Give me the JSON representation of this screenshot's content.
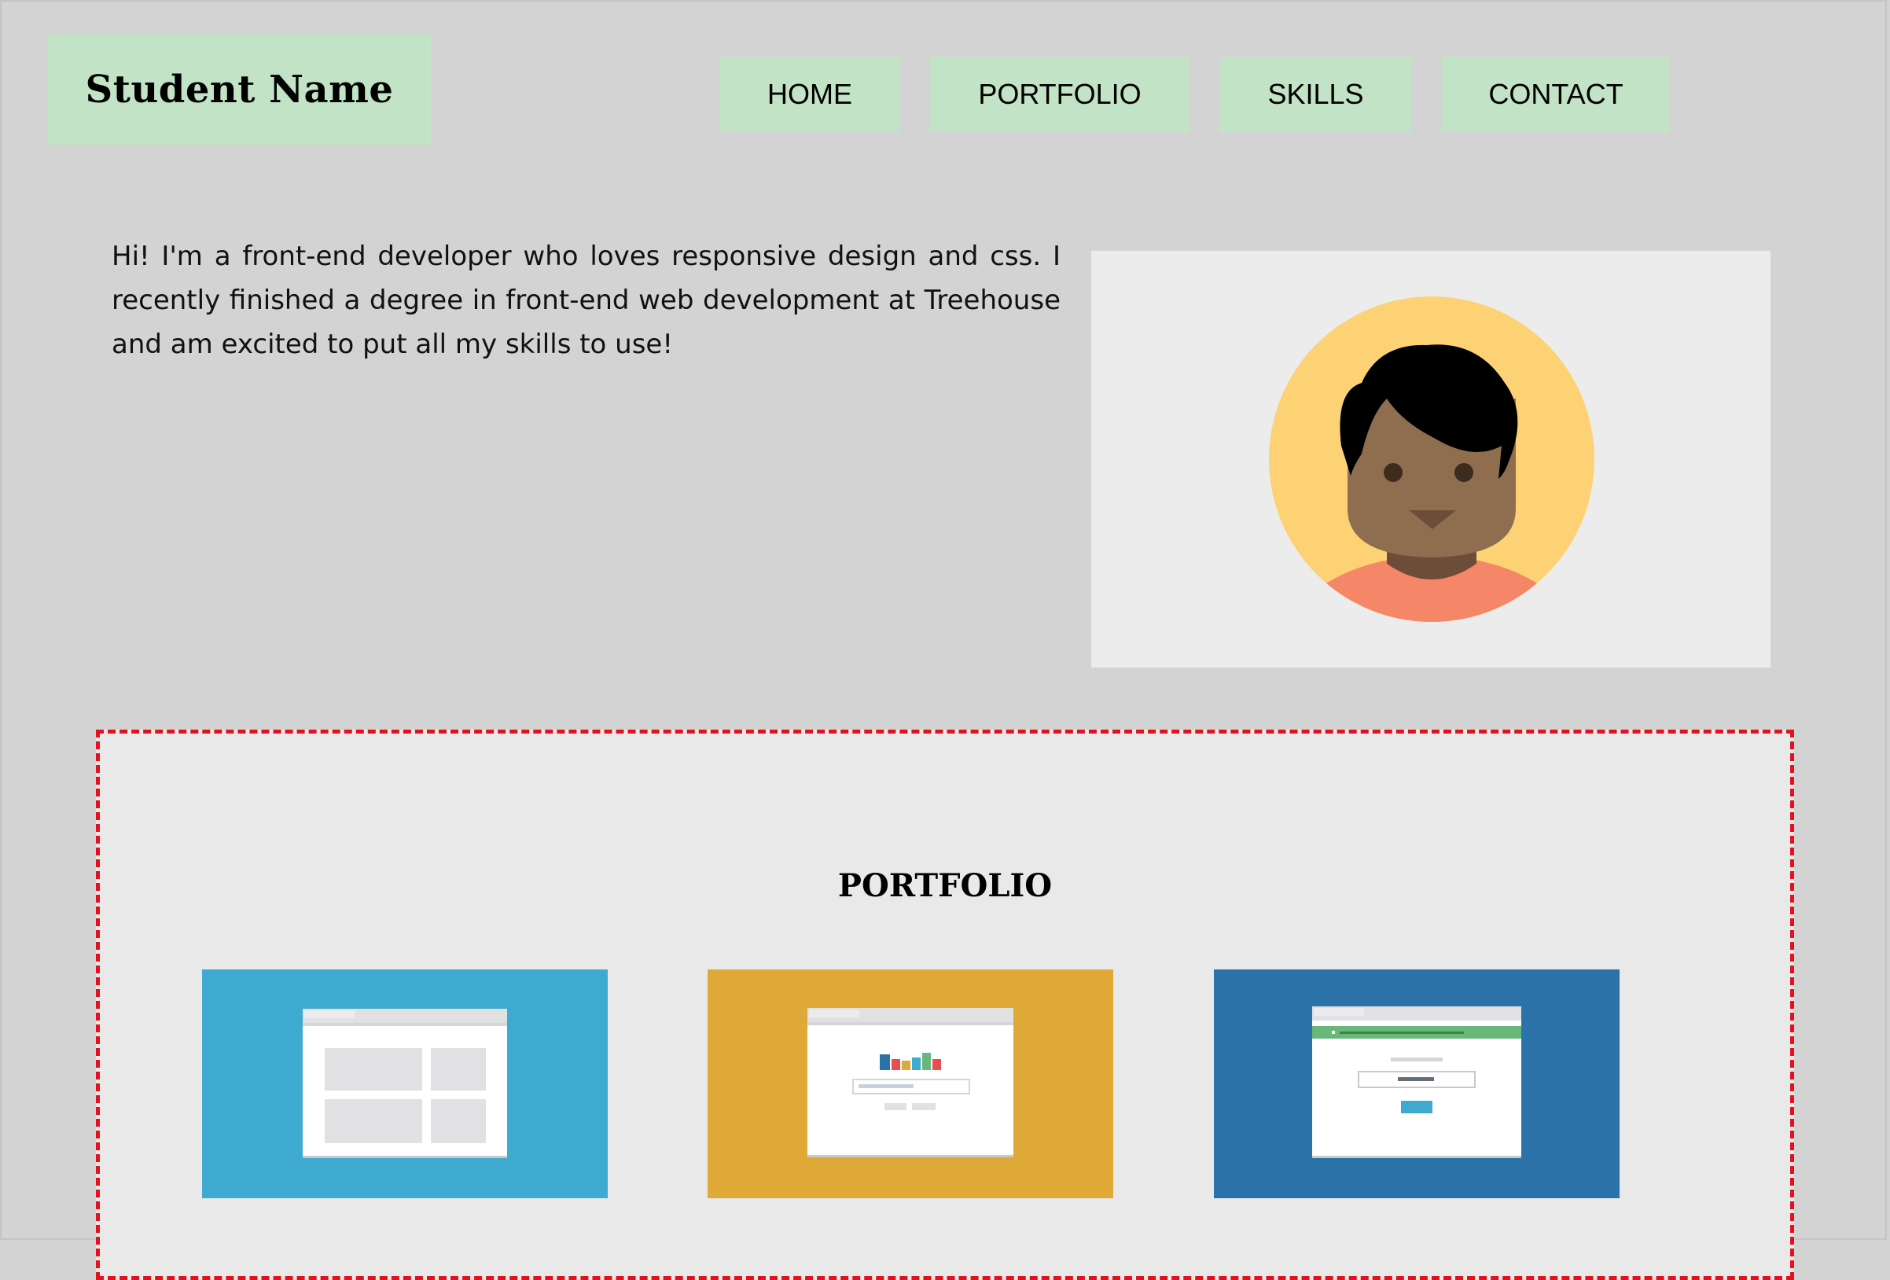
{
  "header": {
    "brand": "Student Name",
    "nav": [
      {
        "label": "HOME"
      },
      {
        "label": "PORTFOLIO"
      },
      {
        "label": "SKILLS"
      },
      {
        "label": "CONTACT"
      }
    ]
  },
  "intro": {
    "text": "Hi! I'm a front-end developer who loves responsive design and css. I recently finished a degree in front-end web development at Treehouse and am excited to put all my skills to use!"
  },
  "portfolio": {
    "title": "PORTFOLIO",
    "cards": [
      {
        "icon": "layout-grid-thumbnail",
        "color": "#3eaacf"
      },
      {
        "icon": "chart-search-thumbnail",
        "color": "#dea937"
      },
      {
        "icon": "form-signup-thumbnail",
        "color": "#2b72a8"
      }
    ]
  },
  "colors": {
    "background": "#d3d3d3",
    "nav_bg": "#c2e3c5",
    "panel_bg": "#ececec",
    "portfolio_border": "#e3101e"
  }
}
